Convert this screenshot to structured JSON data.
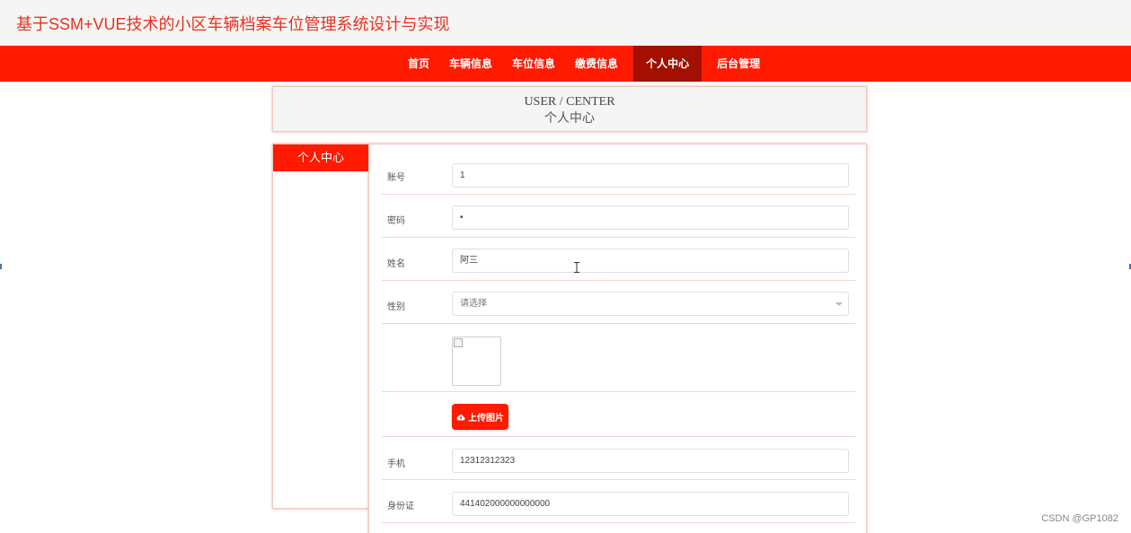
{
  "header": {
    "title": "基于SSM+VUE技术的小区车辆档案车位管理系统设计与实现"
  },
  "nav": {
    "items": [
      {
        "label": "首页",
        "active": false
      },
      {
        "label": "车辆信息",
        "active": false
      },
      {
        "label": "车位信息",
        "active": false
      },
      {
        "label": "缴费信息",
        "active": false
      },
      {
        "label": "个人中心",
        "active": true
      },
      {
        "label": "后台管理",
        "active": false
      }
    ]
  },
  "banner": {
    "title_en": "USER / CENTER",
    "title_cn": "个人中心"
  },
  "sidebar": {
    "heading": "个人中心"
  },
  "form": {
    "account": {
      "label": "账号",
      "value": "1"
    },
    "password": {
      "label": "密码",
      "value": "•"
    },
    "name": {
      "label": "姓名",
      "value": "阿三"
    },
    "gender": {
      "label": "性别",
      "placeholder": "请选择"
    },
    "upload": {
      "label": "上传图片"
    },
    "phone": {
      "label": "手机",
      "value": "12312312323"
    },
    "id_card": {
      "label": "身份证",
      "value": "441402000000000000"
    }
  },
  "watermark": "CSDN @GP1082",
  "colors": {
    "accent": "#ff1a00",
    "nav_active": "#a30f00",
    "title": "#e8321f"
  }
}
